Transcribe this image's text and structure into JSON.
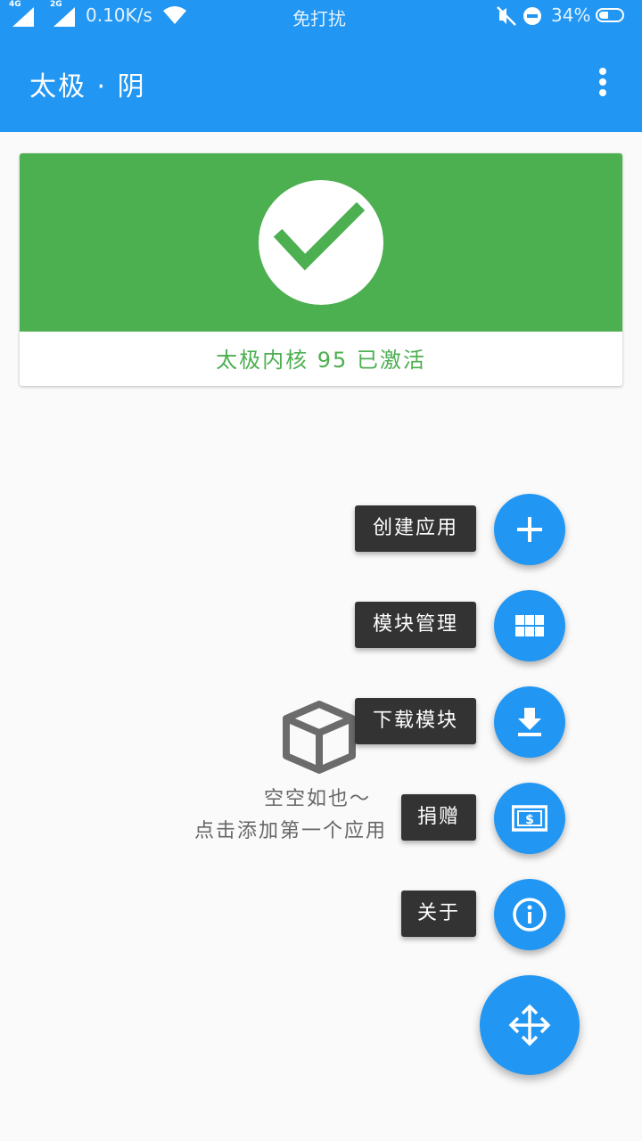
{
  "status_bar": {
    "network_1": "4G",
    "network_2": "2G",
    "speed": "0.10K/s",
    "mode": "免打扰",
    "battery": "34%"
  },
  "app_bar": {
    "title": "太极 · 阴",
    "menu_icon": "more-vert-icon"
  },
  "status_card": {
    "icon": "check-icon",
    "text": "太极内核 95 已激活",
    "color_ok": "#4caf50"
  },
  "empty_state": {
    "icon": "package-icon",
    "line1": "空空如也～",
    "line2": "点击添加第一个应用"
  },
  "speed_dial": {
    "items": [
      {
        "label": "创建应用",
        "icon": "plus-icon"
      },
      {
        "label": "模块管理",
        "icon": "grid-icon"
      },
      {
        "label": "下载模块",
        "icon": "download-icon"
      },
      {
        "label": "捐赠",
        "icon": "money-icon"
      },
      {
        "label": "关于",
        "icon": "info-icon"
      }
    ],
    "main_icon": "move-arrows-icon"
  },
  "colors": {
    "primary": "#2196f3",
    "label_bg": "#333333"
  }
}
